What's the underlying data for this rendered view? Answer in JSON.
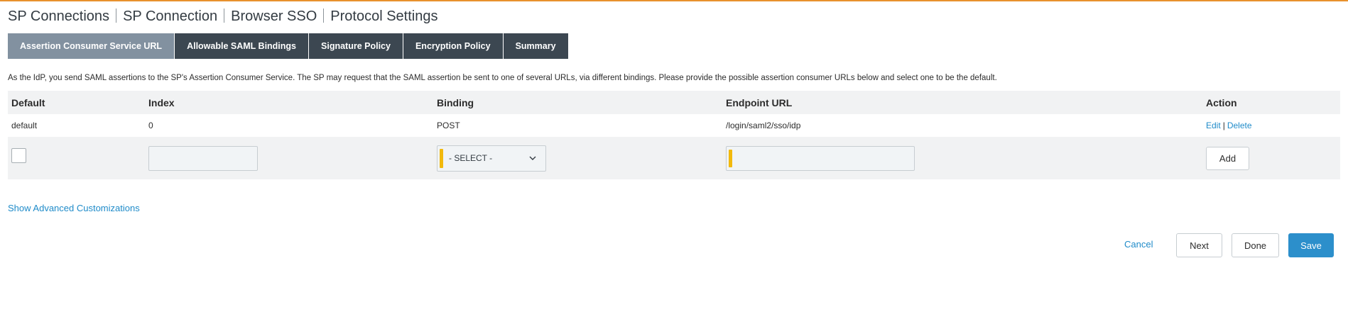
{
  "breadcrumb": [
    "SP Connections",
    "SP Connection",
    "Browser SSO",
    "Protocol Settings"
  ],
  "tabs": [
    {
      "label": "Assertion Consumer Service URL",
      "active": true
    },
    {
      "label": "Allowable SAML Bindings",
      "active": false
    },
    {
      "label": "Signature Policy",
      "active": false
    },
    {
      "label": "Encryption Policy",
      "active": false
    },
    {
      "label": "Summary",
      "active": false
    }
  ],
  "description": "As the IdP, you send SAML assertions to the SP's Assertion Consumer Service. The SP may request that the SAML assertion be sent to one of several URLs, via different bindings. Please provide the possible assertion consumer URLs below and select one to be the default.",
  "table": {
    "headers": {
      "default": "Default",
      "index": "Index",
      "binding": "Binding",
      "endpoint": "Endpoint URL",
      "action": "Action"
    },
    "rows": [
      {
        "default": "default",
        "index": "0",
        "binding": "POST",
        "endpoint": "/login/saml2/sso/idp",
        "edit": "Edit",
        "separator": "|",
        "delete": "Delete"
      }
    ],
    "new_row": {
      "default_checked": false,
      "index_value": "",
      "binding_value": "- SELECT -",
      "endpoint_value": "",
      "add_label": "Add"
    }
  },
  "advanced_link": "Show Advanced Customizations",
  "footer": {
    "cancel": "Cancel",
    "next": "Next",
    "done": "Done",
    "save": "Save"
  },
  "colors": {
    "accent_line": "#e8912d",
    "tab_dark": "#3c4751",
    "tab_active": "#8291a0",
    "link": "#1f8bc9",
    "save": "#2c8fcb",
    "required_marker": "#f2b90d"
  },
  "icons": {
    "select_arrow": "chevron-down-icon"
  }
}
